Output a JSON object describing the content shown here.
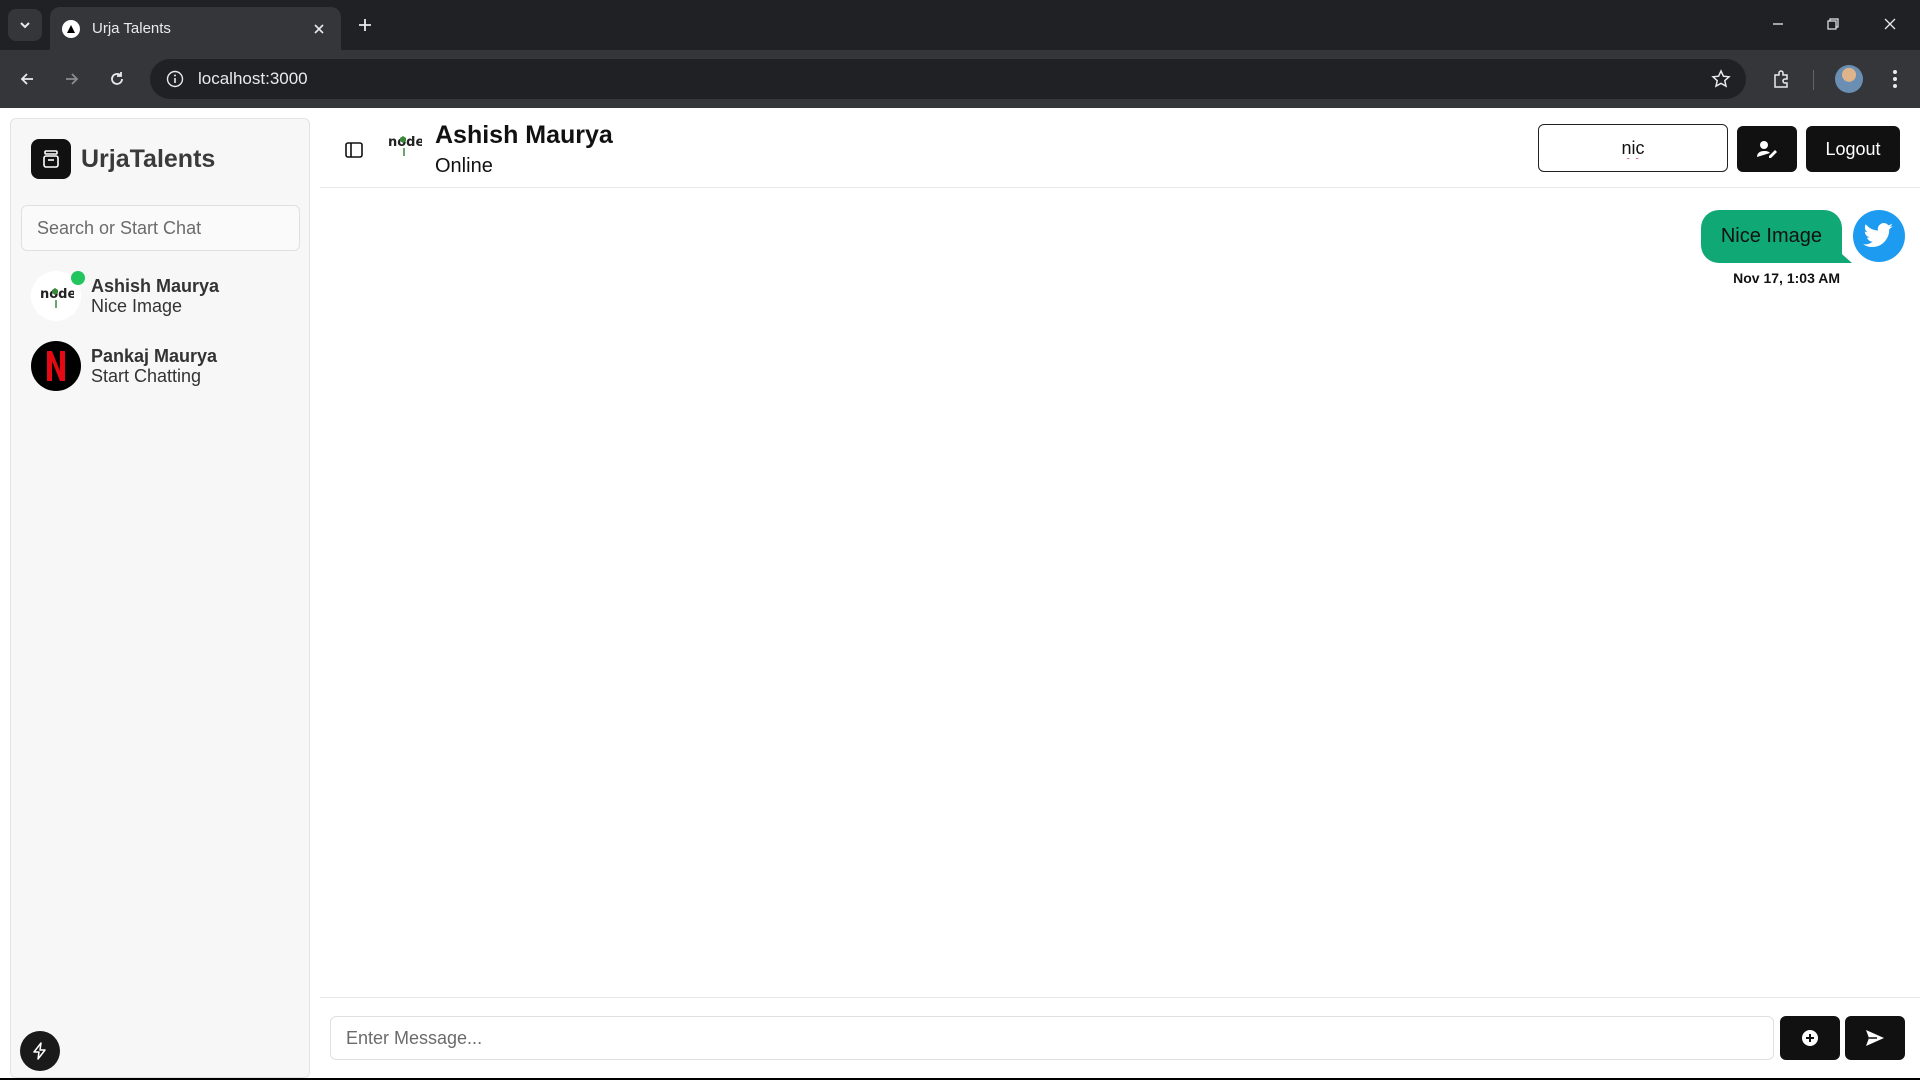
{
  "browser": {
    "tab_title": "Urja Talents",
    "url": "localhost:3000"
  },
  "sidebar": {
    "brand": "UrjaTalents",
    "search_placeholder": "Search or Start Chat",
    "contacts": [
      {
        "name": "Ashish Maurya",
        "last_message": "Nice Image",
        "online": true,
        "avatar_icon": "nodejs-logo-icon"
      },
      {
        "name": "Pankaj Maurya",
        "last_message": "Start Chatting",
        "online": false,
        "avatar_icon": "netflix-logo-icon"
      }
    ]
  },
  "chat": {
    "contact_name": "Ashish Maurya",
    "status": "Online",
    "header_input_value": "nic",
    "logout_label": "Logout",
    "messages": [
      {
        "text": "Nice Image",
        "time": "Nov 17, 1:03 AM",
        "sender_avatar_icon": "twitter-bird-icon"
      }
    ],
    "composer_placeholder": "Enter Message..."
  },
  "colors": {
    "accent_green": "#10a874",
    "online_dot": "#22c55e",
    "twitter_blue": "#1d9bf0",
    "dark_button": "#111111"
  }
}
